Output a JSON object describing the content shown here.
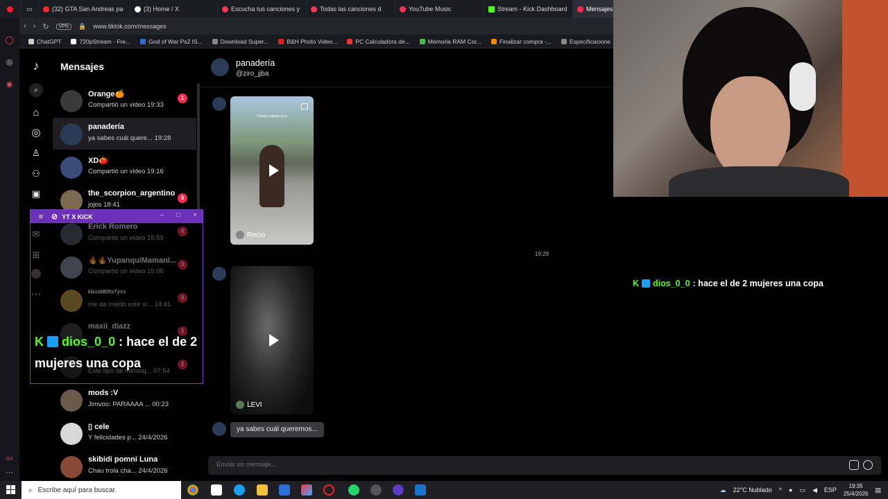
{
  "browser": {
    "tabs": [
      {
        "title": "(32) GTA San Andreas pa",
        "color": "#ff2a2a"
      },
      {
        "title": "(3) Home / X",
        "color": "#ffffff"
      },
      {
        "title": "Escucha tus canciones y",
        "color": "#ff3355"
      },
      {
        "title": "Todas las canciones d",
        "color": "#ff3355"
      },
      {
        "title": "YouTube Music",
        "color": "#ff3355"
      },
      {
        "title": "Stream - Kick Dashboard",
        "color": "#53fc18"
      },
      {
        "title": "Mensajes |",
        "color": "#fe2c55"
      }
    ],
    "vpn": "VPN",
    "url": "www.tiktok.com/messages",
    "bookmarks": [
      {
        "label": "ChatGPT",
        "color": "#cccccc"
      },
      {
        "label": "720pStream - Fre...",
        "color": "#ffffff"
      },
      {
        "label": "God of War Ps2 IS...",
        "color": "#2a6bd1"
      },
      {
        "label": "Download Super...",
        "color": "#888888"
      },
      {
        "label": "B&H Photo Video...",
        "color": "#d22"
      },
      {
        "label": "PC Calculadora de...",
        "color": "#e33"
      },
      {
        "label": "Memoria RAM Cor...",
        "color": "#4b4"
      },
      {
        "label": "Finalizar compra -...",
        "color": "#e80"
      },
      {
        "label": "Especificacione",
        "color": "#888888"
      }
    ]
  },
  "tiktok": {
    "title": "Mensajes",
    "conversations": [
      {
        "name": "Orange🍊",
        "preview": "Compartió un video 19:33",
        "badge": "1",
        "avatar": "#3a3a3a"
      },
      {
        "name": "panadería",
        "preview": "ya sabes cuál quere...  19:28",
        "badge": "",
        "avatar": "#2b3b55"
      },
      {
        "name": "XD🍅",
        "preview": "Compartió un video 19:16",
        "badge": "",
        "avatar": "#3a4c7a"
      },
      {
        "name": "the_scorpion_argentino",
        "preview": "jojos 18:41",
        "badge": "6",
        "avatar": "#7a6a52"
      },
      {
        "name": "Erick Romero",
        "preview": "Compartió un video 16:59",
        "badge": "4",
        "avatar": "#5a5f6a"
      },
      {
        "name": "🔥🔥YupanquiMamani...",
        "preview": "Compartió un video 15:06",
        "badge": "3",
        "avatar": "#8a9aa8"
      },
      {
        "name": "ᵏˡᵃˢˢᴹᴱᴿˢᵀʸˢˢ",
        "preview": "me da miedo este vi... 14:41",
        "badge": "3",
        "avatar": "#c8a14a"
      },
      {
        "name": "maxii_diazz",
        "preview": "",
        "badge": "2",
        "avatar": "#444"
      },
      {
        "name": "",
        "preview": "Este tipo de mensaj... 07:54",
        "badge": "2",
        "avatar": "#333"
      },
      {
        "name": "mods :V",
        "preview": "Jimvoo: PARAAAA ... 00:23",
        "badge": "",
        "avatar": "#6a5a4a"
      },
      {
        "name": "▯ cele",
        "preview": "Y felicidades p... 24/4/2026",
        "badge": "",
        "avatar": "#d8d8d8"
      },
      {
        "name": "skibidi pomni Luna",
        "preview": "Chau trola cha... 24/4/2026",
        "badge": "",
        "avatar": "#8a4a3a"
      }
    ],
    "chat": {
      "name": "panadería",
      "handle": "@ziro_jjba",
      "video1_caption": "Chicas cuando fui a",
      "video1_tag": "Rocío",
      "timestamp": "19:28",
      "video2_tag": "ᒪEVI",
      "bubble": "ya sabes cuál queremos...",
      "composer_placeholder": "Enviar un mensaje..."
    }
  },
  "overlay": {
    "window_title": "YT X KICK",
    "username": "dios_0_0",
    "message": ": hace el de 2 mujeres una copa"
  },
  "taskbar": {
    "search_placeholder": "Escribe aquí para buscar.",
    "weather": "22°C  Nublado",
    "lang": "ESP",
    "time": "19:35",
    "date": "25/4/2026"
  }
}
